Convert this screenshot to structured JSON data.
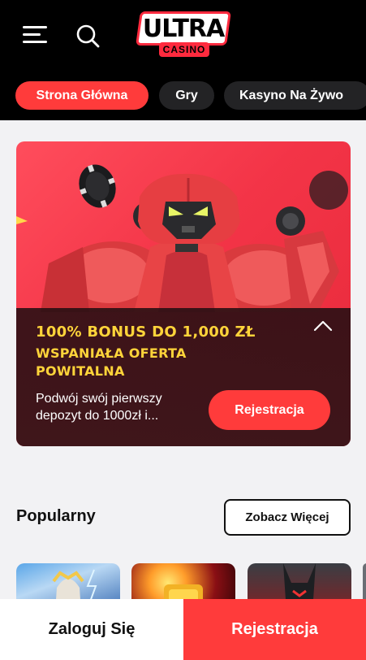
{
  "header": {
    "logo_text": "ULTRA",
    "logo_sub": "CASINO",
    "menu_icon": "hamburger-menu-icon",
    "search_icon": "search-icon"
  },
  "tabs": [
    {
      "label": "Strona Główna",
      "active": true
    },
    {
      "label": "Gry",
      "active": false
    },
    {
      "label": "Kasyno Na Żywo",
      "active": false
    }
  ],
  "promo": {
    "headline": "100% BONUS DO 1,000 ZŁ",
    "subheadline": "WSPANIAŁA OFERTA POWITALNA",
    "description": "Podwój swój pierwszy depozyt do 1000zł i...",
    "button_label": "Rejestracja",
    "collapse_icon": "chevron-up-icon"
  },
  "popular": {
    "title": "Popularny",
    "see_more_label": "Zobacz Więcej"
  },
  "bottom_bar": {
    "login_label": "Zaloguj Się",
    "register_label": "Rejestracja"
  },
  "colors": {
    "accent": "#ff3b3b",
    "header_bg": "#000000",
    "tab_bg": "#232325",
    "promo_text": "#ffd43a",
    "page_bg": "#f2f2f4"
  }
}
